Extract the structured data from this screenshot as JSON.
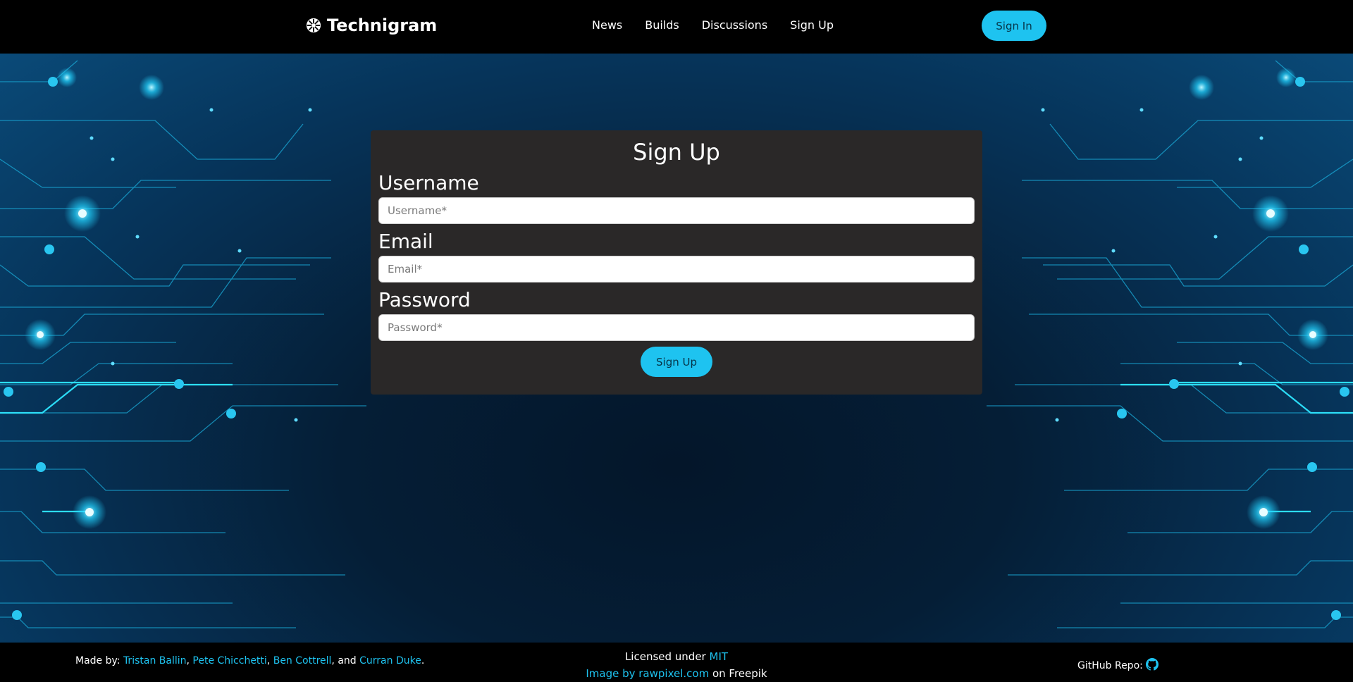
{
  "brand": {
    "name": "Technigram"
  },
  "nav": {
    "links": [
      "News",
      "Builds",
      "Discussions",
      "Sign Up"
    ],
    "signin_label": "Sign In"
  },
  "form": {
    "title": "Sign Up",
    "username_label": "Username",
    "username_placeholder": "Username*",
    "email_label": "Email",
    "email_placeholder": "Email*",
    "password_label": "Password",
    "password_placeholder": "Password*",
    "submit_label": "Sign Up"
  },
  "footer": {
    "made_by_prefix": "Made by:",
    "authors": [
      "Tristan Ballin",
      "Pete Chicchetti",
      "Ben Cottrell",
      "Curran Duke"
    ],
    "sep1": ",",
    "sep2": ",",
    "sep3": ", and",
    "end": ".",
    "license_prefix": "Licensed under",
    "license_name": "MIT",
    "image_credit_link": "Image by rawpixel.com",
    "image_credit_suffix": "on Freepik",
    "github_label": "GitHub Repo:"
  },
  "colors": {
    "accent": "#1ec3f0",
    "card_bg": "#2a2828",
    "header_bg": "#000000"
  }
}
